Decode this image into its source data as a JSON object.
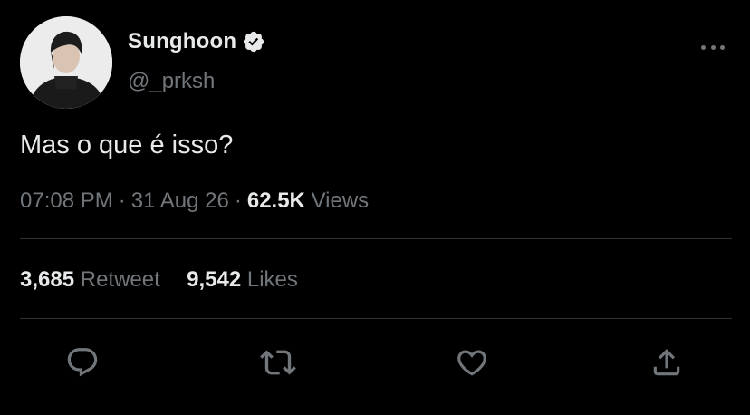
{
  "author": {
    "display_name": "Sunghoon",
    "handle": "@_prksh"
  },
  "tweet": {
    "text": "Mas o que é isso?",
    "time": "07:08 PM",
    "date": "31 Aug 26",
    "views_count": "62.5K",
    "views_label": "Views"
  },
  "stats": {
    "retweet_count": "3,685",
    "retweet_label": "Retweet",
    "likes_count": "9,542",
    "likes_label": "Likes"
  },
  "separator": "·",
  "icons": {
    "verified": "verified-badge-icon",
    "more": "more-icon",
    "reply": "reply-icon",
    "retweet": "retweet-icon",
    "like": "heart-icon",
    "share": "share-icon"
  },
  "colors": {
    "background": "#000000",
    "primary_text": "#e7e9ea",
    "secondary_text": "#71767b",
    "divider": "#2f3336",
    "icon": "#71767b"
  }
}
